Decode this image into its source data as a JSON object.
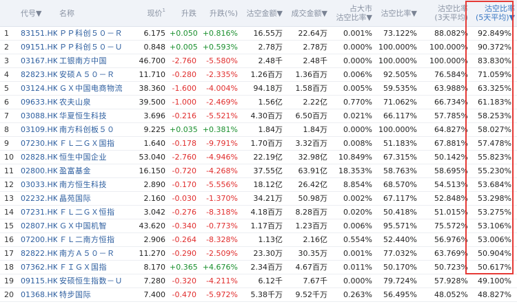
{
  "header": {
    "index": "",
    "code": "代号",
    "name": "名称",
    "price": "现价",
    "change": "升跌",
    "change_pct": "升跌(%)",
    "short_amount": "沽空金额",
    "turnover": "成交金额",
    "market_share_l1": "占大市",
    "market_share_l2": "沽空比率",
    "short_ratio": "沽空比率",
    "ratio3_l1": "沽空比率",
    "ratio3_l2": "(3天平均)",
    "ratio5_l1": "沽空比率",
    "ratio5_l2": "(5天平均)",
    "sort_arrow": "▼",
    "superscript": "1"
  },
  "highlight_color": "#e53935",
  "rows": [
    {
      "idx": "1",
      "code": "83151.HK",
      "name": "ＰＰ科创５０－Ｒ",
      "price": "6.175",
      "change": "+0.050",
      "pct": "+0.816%",
      "short": "16.55万",
      "turnover": "22.64万",
      "share": "0.001%",
      "ratio": "73.122%",
      "r3": "88.082%",
      "r5": "92.849%",
      "dir": "up"
    },
    {
      "idx": "2",
      "code": "09151.HK",
      "name": "ＰＰ科创５０－Ｕ",
      "price": "0.848",
      "change": "+0.005",
      "pct": "+0.593%",
      "short": "2.78万",
      "turnover": "2.78万",
      "share": "0.000%",
      "ratio": "100.000%",
      "r3": "100.000%",
      "r5": "90.372%",
      "dir": "up"
    },
    {
      "idx": "3",
      "code": "03167.HK",
      "name": "工银南方中国",
      "price": "46.700",
      "change": "-2.760",
      "pct": "-5.580%",
      "short": "2.48千",
      "turnover": "2.48千",
      "share": "0.000%",
      "ratio": "100.000%",
      "r3": "100.000%",
      "r5": "83.830%",
      "dir": "down"
    },
    {
      "idx": "4",
      "code": "82823.HK",
      "name": "安硕Ａ５０－Ｒ",
      "price": "11.710",
      "change": "-0.280",
      "pct": "-2.335%",
      "short": "1.26百万",
      "turnover": "1.36百万",
      "share": "0.006%",
      "ratio": "92.505%",
      "r3": "76.584%",
      "r5": "71.059%",
      "dir": "down"
    },
    {
      "idx": "5",
      "code": "03124.HK",
      "name": "ＧＸ中国电商物流",
      "price": "38.360",
      "change": "-1.600",
      "pct": "-4.004%",
      "short": "94.18万",
      "turnover": "1.58百万",
      "share": "0.005%",
      "ratio": "59.535%",
      "r3": "63.988%",
      "r5": "63.325%",
      "dir": "down"
    },
    {
      "idx": "6",
      "code": "09633.HK",
      "name": "农夫山泉",
      "price": "39.500",
      "change": "-1.000",
      "pct": "-2.469%",
      "short": "1.56亿",
      "turnover": "2.22亿",
      "share": "0.770%",
      "ratio": "71.062%",
      "r3": "66.734%",
      "r5": "61.183%",
      "dir": "down"
    },
    {
      "idx": "7",
      "code": "03088.HK",
      "name": "华夏恒生科技",
      "price": "3.696",
      "change": "-0.216",
      "pct": "-5.521%",
      "short": "4.30百万",
      "turnover": "6.50百万",
      "share": "0.021%",
      "ratio": "66.117%",
      "r3": "57.785%",
      "r5": "58.253%",
      "dir": "down"
    },
    {
      "idx": "8",
      "code": "03109.HK",
      "name": "南方科创板５０",
      "price": "9.225",
      "change": "+0.035",
      "pct": "+0.381%",
      "short": "1.84万",
      "turnover": "1.84万",
      "share": "0.000%",
      "ratio": "100.000%",
      "r3": "64.827%",
      "r5": "58.027%",
      "dir": "up"
    },
    {
      "idx": "9",
      "code": "07230.HK",
      "name": "ＦＬ二ＧＸ国指",
      "price": "1.640",
      "change": "-0.178",
      "pct": "-9.791%",
      "short": "1.70百万",
      "turnover": "3.32百万",
      "share": "0.008%",
      "ratio": "51.183%",
      "r3": "67.881%",
      "r5": "57.478%",
      "dir": "down"
    },
    {
      "idx": "10",
      "code": "02828.HK",
      "name": "恒生中国企业",
      "price": "53.040",
      "change": "-2.760",
      "pct": "-4.946%",
      "short": "22.19亿",
      "turnover": "32.98亿",
      "share": "10.849%",
      "ratio": "67.315%",
      "r3": "50.142%",
      "r5": "55.823%",
      "dir": "down"
    },
    {
      "idx": "11",
      "code": "02800.HK",
      "name": "盈富基金",
      "price": "16.150",
      "change": "-0.720",
      "pct": "-4.268%",
      "short": "37.55亿",
      "turnover": "63.91亿",
      "share": "18.353%",
      "ratio": "58.763%",
      "r3": "58.695%",
      "r5": "55.230%",
      "dir": "down"
    },
    {
      "idx": "12",
      "code": "03033.HK",
      "name": "南方恒生科技",
      "price": "2.890",
      "change": "-0.170",
      "pct": "-5.556%",
      "short": "18.12亿",
      "turnover": "26.42亿",
      "share": "8.854%",
      "ratio": "68.570%",
      "r3": "54.513%",
      "r5": "53.684%",
      "dir": "down"
    },
    {
      "idx": "13",
      "code": "02232.HK",
      "name": "晶苑国际",
      "price": "2.160",
      "change": "-0.030",
      "pct": "-1.370%",
      "short": "34.21万",
      "turnover": "50.98万",
      "share": "0.002%",
      "ratio": "67.117%",
      "r3": "52.848%",
      "r5": "53.298%",
      "dir": "down"
    },
    {
      "idx": "14",
      "code": "07231.HK",
      "name": "ＦＬ二ＧＸ恒指",
      "price": "3.042",
      "change": "-0.276",
      "pct": "-8.318%",
      "short": "4.18百万",
      "turnover": "8.28百万",
      "share": "0.020%",
      "ratio": "50.418%",
      "r3": "51.015%",
      "r5": "53.275%",
      "dir": "down"
    },
    {
      "idx": "15",
      "code": "02807.HK",
      "name": "ＧＸ中国机智",
      "price": "43.620",
      "change": "-0.340",
      "pct": "-0.773%",
      "short": "1.17百万",
      "turnover": "1.23百万",
      "share": "0.006%",
      "ratio": "95.571%",
      "r3": "75.572%",
      "r5": "53.106%",
      "dir": "down"
    },
    {
      "idx": "16",
      "code": "07200.HK",
      "name": "ＦＬ二南方恒指",
      "price": "2.906",
      "change": "-0.264",
      "pct": "-8.328%",
      "short": "1.13亿",
      "turnover": "2.16亿",
      "share": "0.554%",
      "ratio": "52.440%",
      "r3": "56.976%",
      "r5": "53.006%",
      "dir": "down"
    },
    {
      "idx": "17",
      "code": "82822.HK",
      "name": "南方Ａ５０－Ｒ",
      "price": "11.270",
      "change": "-0.290",
      "pct": "-2.509%",
      "short": "23.30万",
      "turnover": "30.35万",
      "share": "0.001%",
      "ratio": "77.032%",
      "r3": "63.769%",
      "r5": "50.904%",
      "dir": "down"
    },
    {
      "idx": "18",
      "code": "07362.HK",
      "name": "ＦＩＧＸ国指",
      "price": "8.170",
      "change": "+0.365",
      "pct": "+4.676%",
      "short": "2.34百万",
      "turnover": "4.67百万",
      "share": "0.011%",
      "ratio": "50.170%",
      "r3": "50.723%",
      "r5": "50.617%",
      "dir": "up"
    },
    {
      "idx": "19",
      "code": "09115.HK",
      "name": "安硕恒生指数－Ｕ",
      "price": "7.280",
      "change": "-0.320",
      "pct": "-4.211%",
      "short": "6.12千",
      "turnover": "7.67千",
      "share": "0.000%",
      "ratio": "79.724%",
      "r3": "57.928%",
      "r5": "49.100%",
      "dir": "down"
    },
    {
      "idx": "20",
      "code": "01368.HK",
      "name": "特步国际",
      "price": "7.400",
      "change": "-0.470",
      "pct": "-5.972%",
      "short": "5.38千万",
      "turnover": "9.52千万",
      "share": "0.263%",
      "ratio": "56.495%",
      "r3": "48.052%",
      "r5": "48.827%",
      "dir": "down"
    }
  ]
}
